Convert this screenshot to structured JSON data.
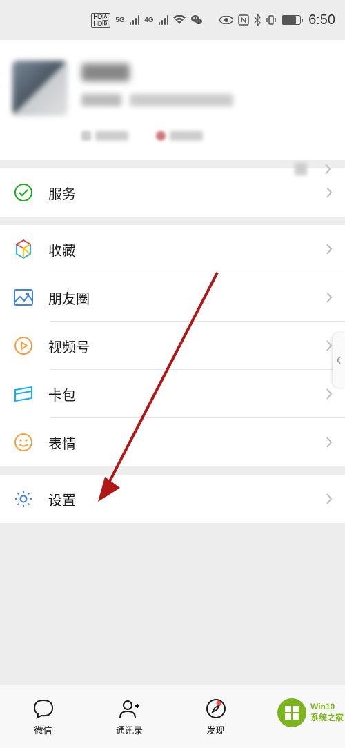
{
  "status": {
    "time": "6:50"
  },
  "menu": {
    "services": "服务",
    "favorites": "收藏",
    "moments": "朋友圈",
    "channels": "视频号",
    "cards": "卡包",
    "stickers": "表情",
    "settings": "设置"
  },
  "nav": {
    "chat": "微信",
    "contacts": "通讯录",
    "discover": "发现"
  },
  "watermark": {
    "line1": "Win10",
    "line2": "系统之家"
  },
  "colors": {
    "green": "#1aad19",
    "orange": "#fa9d3b",
    "blue": "#3d83e6",
    "cyan": "#10aeff",
    "yellow": "#ffc300"
  }
}
